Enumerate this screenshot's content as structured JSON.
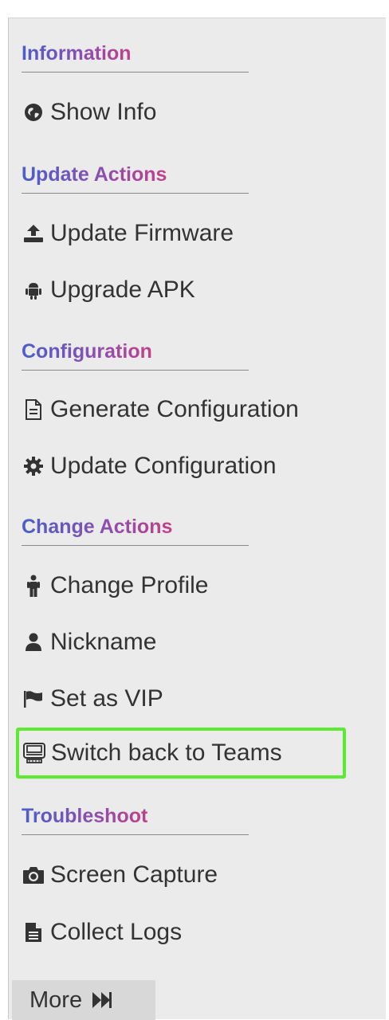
{
  "sections": {
    "information": {
      "title": "Information",
      "items": [
        "Show Info"
      ]
    },
    "update_actions": {
      "title": "Update Actions",
      "items": [
        "Update Firmware",
        "Upgrade APK"
      ]
    },
    "configuration": {
      "title": "Configuration",
      "items": [
        "Generate Configuration",
        "Update Configuration"
      ]
    },
    "change_actions": {
      "title": "Change Actions",
      "items": [
        "Change Profile",
        "Nickname",
        "Set as VIP",
        "Switch back to Teams"
      ]
    },
    "troubleshoot": {
      "title": "Troubleshoot",
      "items": [
        "Screen Capture",
        "Collect Logs"
      ]
    }
  },
  "more": {
    "label": "More"
  },
  "highlight": {
    "item": "Switch back to Teams",
    "color": "#5dea32"
  },
  "colors": {
    "text": "#333333",
    "panel_bg": "#ebebeb",
    "header_gradient": [
      "#4a5fc8",
      "#c0418a"
    ]
  },
  "icons": {
    "show_info": "globe-icon",
    "update_firmware": "upload-icon",
    "upgrade_apk": "android-icon",
    "generate_configuration": "document-icon",
    "update_configuration": "gear-icon",
    "change_profile": "person-icon",
    "nickname": "user-icon",
    "set_as_vip": "flag-icon",
    "switch_back_to_teams": "device-icon",
    "screen_capture": "camera-icon",
    "collect_logs": "file-text-icon",
    "more": "fast-forward-icon"
  }
}
